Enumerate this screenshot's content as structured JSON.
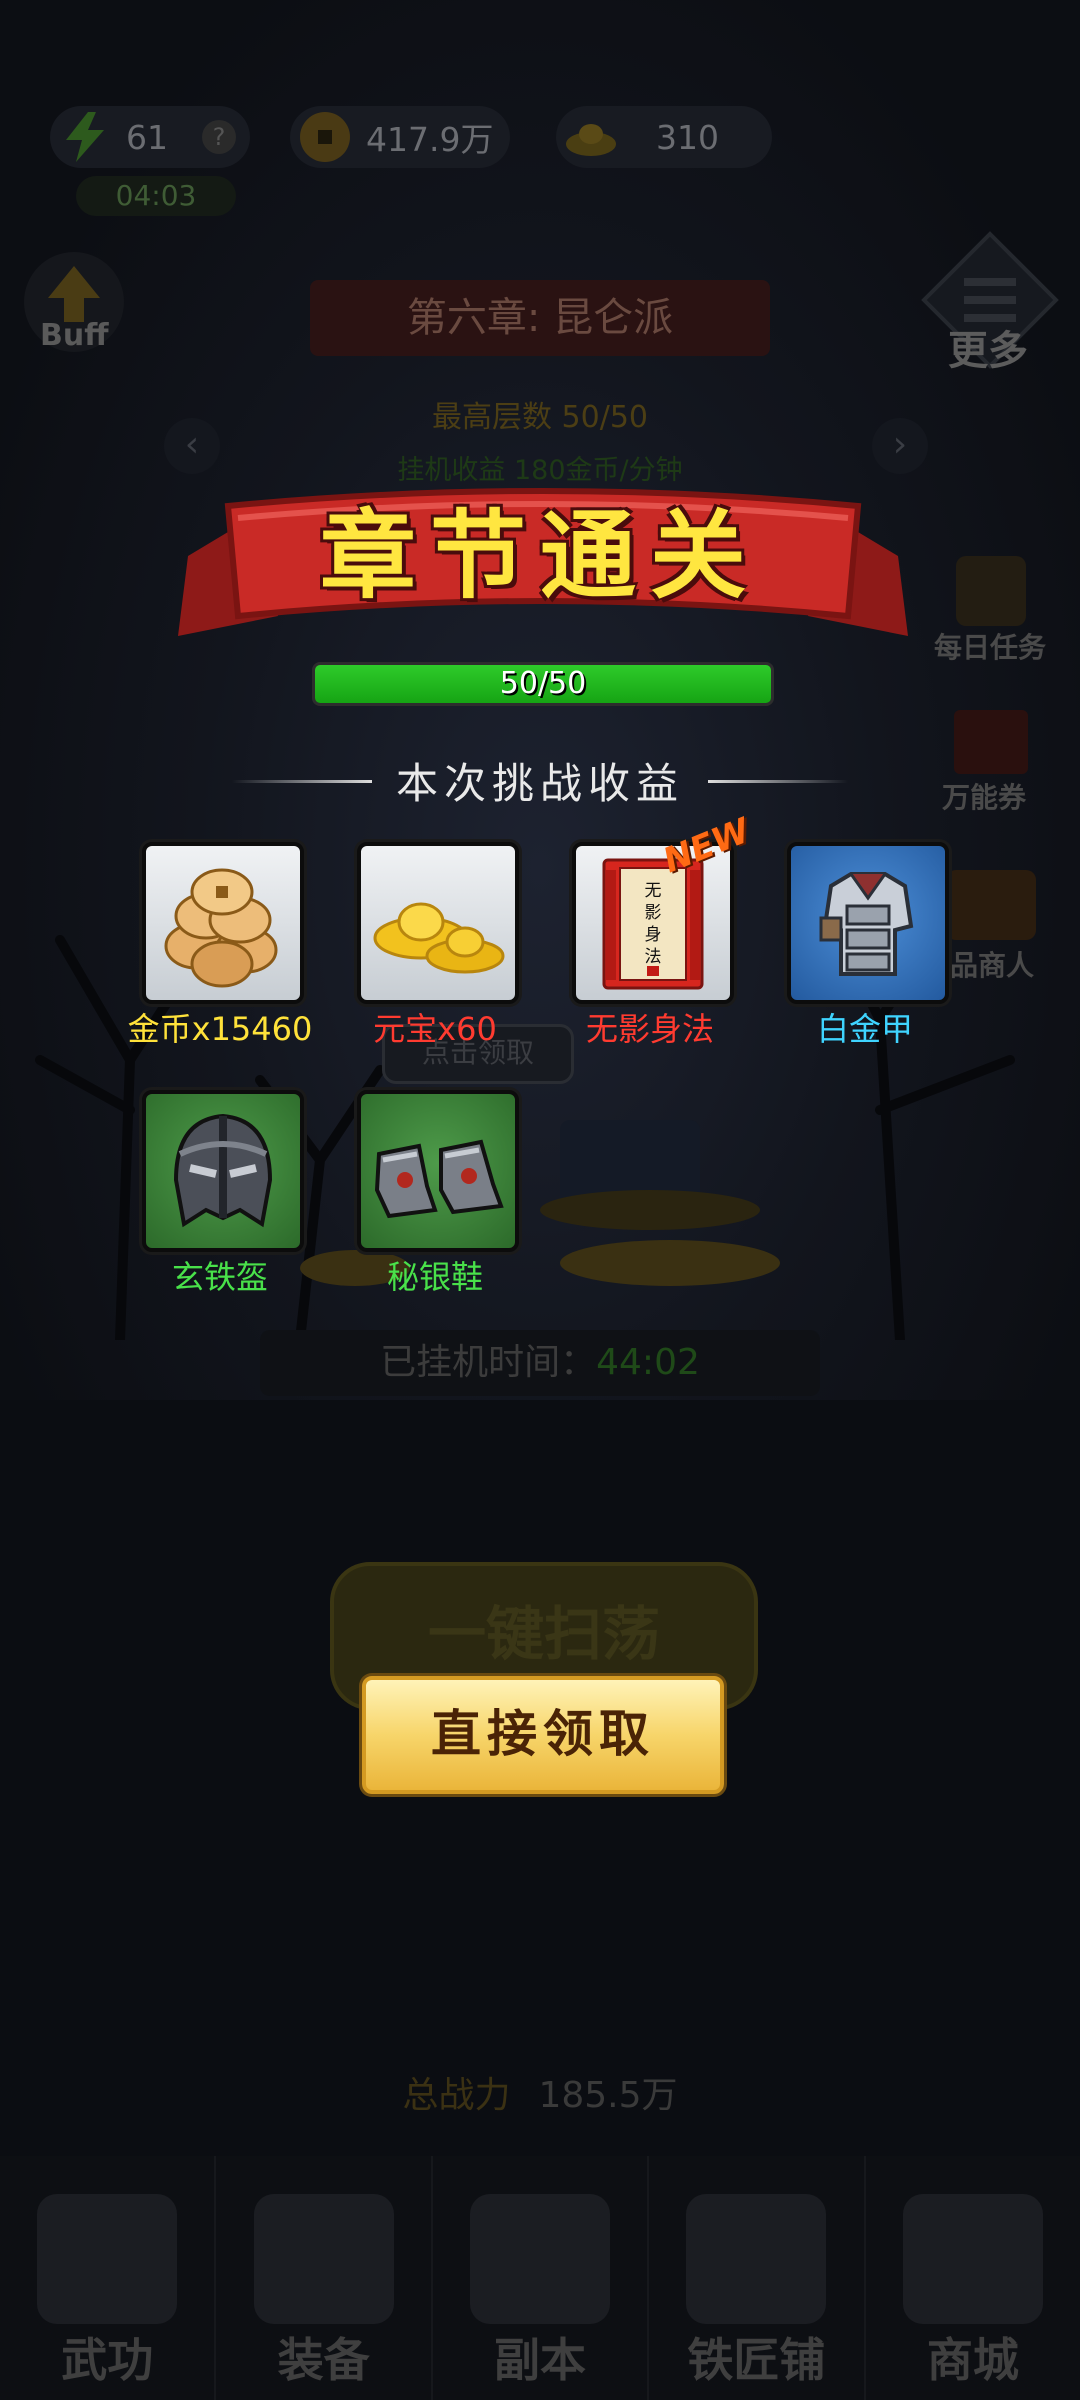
{
  "top_bar": {
    "energy": "61",
    "energy_help": "?",
    "coins": "417.9万",
    "ingots": "310",
    "energy_timer": "04:03"
  },
  "left_buttons": {
    "buff": "Buff"
  },
  "right_buttons": {
    "more": "更多",
    "daily_tasks": "每日任务",
    "voucher": "万能券",
    "merchant": "品商人"
  },
  "stage": {
    "chapter": "第六章: 昆仑派",
    "max_floor": "最高层数 50/50",
    "idle_income": "挂机收益 180金币/分钟"
  },
  "popup": {
    "title": "章节通关",
    "progress_text": "50/50",
    "progress_fraction": 1.0,
    "reward_heading": "本次挑战收益",
    "new_tag": "NEW",
    "rewards": [
      {
        "name": "金币x15460",
        "color": "#ffe23a",
        "icon": "gold-coins-icon",
        "bg": "grey"
      },
      {
        "name": "元宝x60",
        "color": "#ff3b30",
        "icon": "gold-ingot-icon",
        "bg": "grey"
      },
      {
        "name": "无影身法",
        "color": "#ff3b30",
        "icon": "skill-book-icon",
        "bg": "grey",
        "book_text": "无影身法"
      },
      {
        "name": "白金甲",
        "color": "#3fd4ff",
        "icon": "armor-icon",
        "bg": "blue"
      },
      {
        "name": "玄铁盔",
        "color": "#49e14a",
        "icon": "helmet-icon",
        "bg": "green"
      },
      {
        "name": "秘银鞋",
        "color": "#49e14a",
        "icon": "boots-icon",
        "bg": "green"
      }
    ],
    "claim_button": "直接领取"
  },
  "background": {
    "collect_tip": "点击领取",
    "idle_time_label": "已挂机时间：",
    "idle_time_value": "44:02",
    "sweep_button": "一键扫荡",
    "power_label": "总战力",
    "power_value": "185.5万"
  },
  "bottom_nav": [
    {
      "label": "武功",
      "icon": "scroll-icon"
    },
    {
      "label": "装备",
      "icon": "armor-icon"
    },
    {
      "label": "副本",
      "icon": "swords-icon"
    },
    {
      "label": "铁匠铺",
      "icon": "hammer-icon"
    },
    {
      "label": "商城",
      "icon": "gift-box-icon"
    }
  ]
}
